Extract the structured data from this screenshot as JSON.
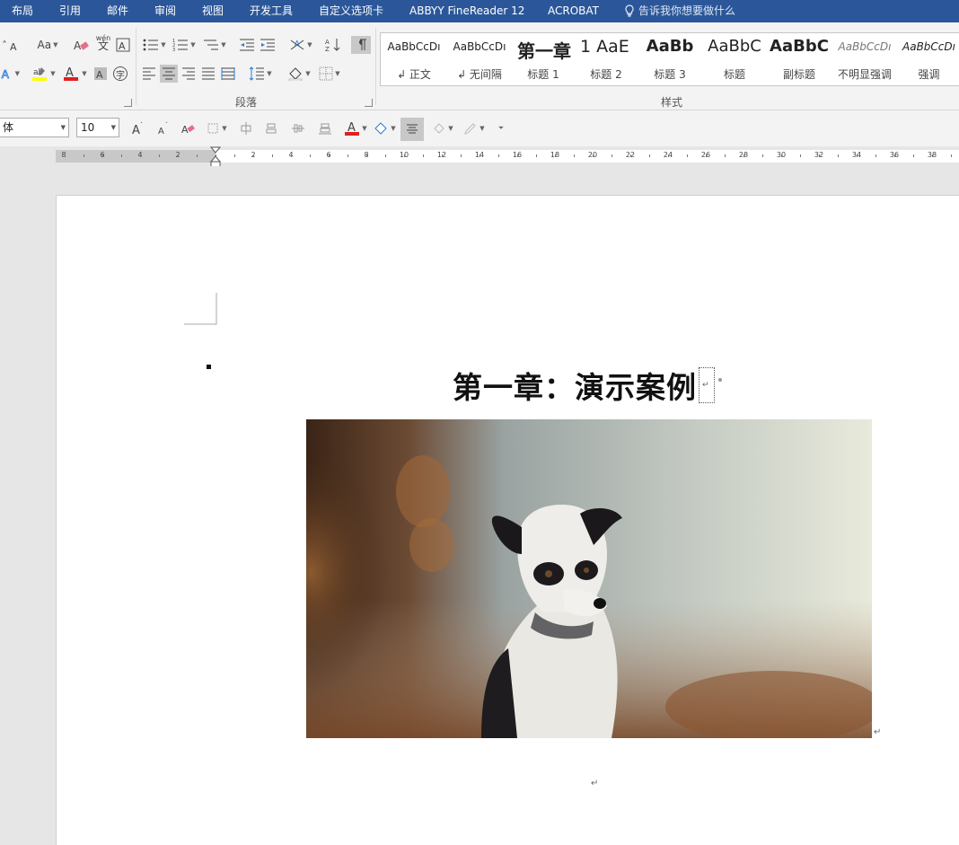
{
  "menu": {
    "tabs": [
      "布局",
      "引用",
      "邮件",
      "审阅",
      "视图",
      "开发工具",
      "自定义选项卡",
      "ABBYY FineReader 12",
      "ACROBAT"
    ],
    "tell_me": "告诉我你想要做什么"
  },
  "ribbon": {
    "paragraph_group_label": "段落",
    "styles_group_label": "样式",
    "phonetic_guide": "wén",
    "phonetic_char": "文",
    "change_case": "Aa",
    "enclose_char": "字",
    "styles": [
      {
        "sample": "AaBbCcDı",
        "name": "↲ 正文"
      },
      {
        "sample": "AaBbCcDı",
        "name": "↲ 无间隔"
      },
      {
        "sample": "第一章",
        "name": "标题 1"
      },
      {
        "sample": "1  AaE",
        "name": "标题 2"
      },
      {
        "sample": "AaBb",
        "name": "标题 3"
      },
      {
        "sample": "AaBbC",
        "name": "标题"
      },
      {
        "sample": "AaBbC",
        "name": "副标题"
      },
      {
        "sample": "AaBbCcDı",
        "name": "不明显强调"
      },
      {
        "sample": "AaBbCcDı",
        "name": "强调"
      }
    ]
  },
  "minibar": {
    "font_name": "体",
    "font_size": "10"
  },
  "ruler": {
    "left_numbers": [
      "8",
      "6",
      "4",
      "2"
    ],
    "right_numbers": [
      "2",
      "4",
      "6",
      "8",
      "10",
      "12",
      "14",
      "16",
      "18",
      "20",
      "22",
      "24",
      "26",
      "28",
      "30",
      "32",
      "34",
      "36",
      "38"
    ]
  },
  "document": {
    "heading": "第一章：演示案例",
    "image_subject": "dog-photo",
    "paragraph_mark": "↵"
  },
  "colors": {
    "tab_bar": "#2b579a",
    "font_color_red": "#e02020",
    "highlight_yellow": "#ffff00"
  }
}
